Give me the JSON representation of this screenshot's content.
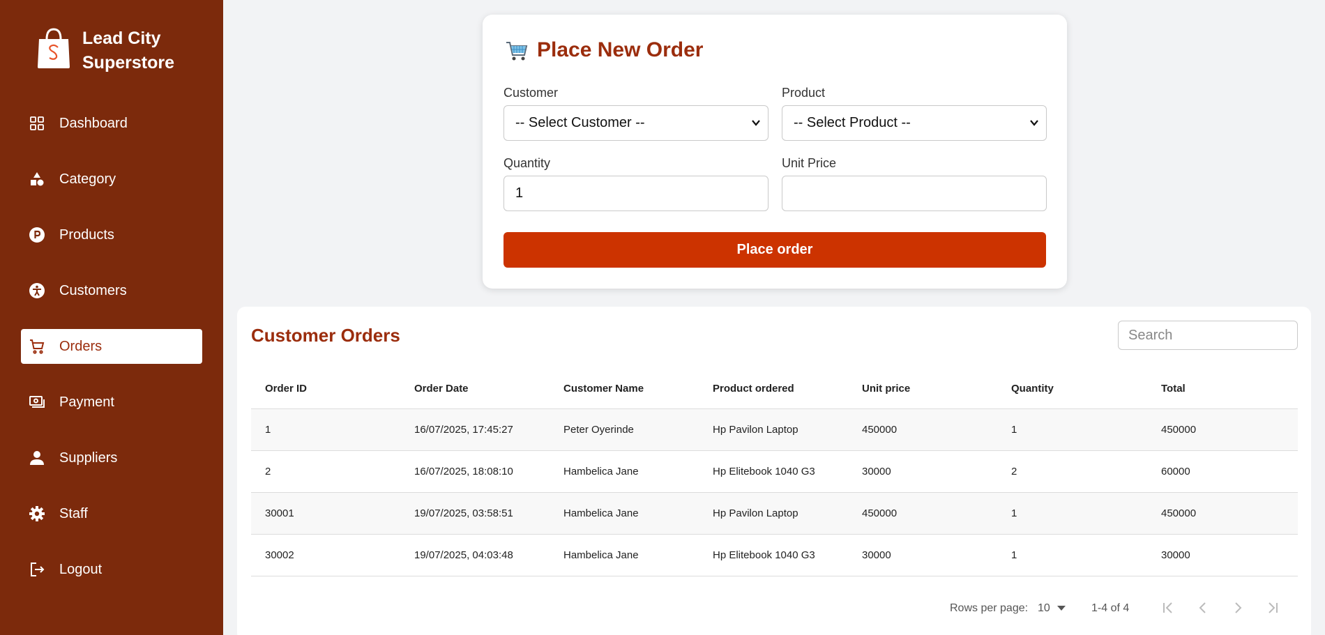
{
  "brand": {
    "line1": "Lead City",
    "line2": "Superstore"
  },
  "nav": [
    {
      "label": "Dashboard",
      "icon": "dashboard-icon"
    },
    {
      "label": "Category",
      "icon": "category-icon"
    },
    {
      "label": "Products",
      "icon": "products-icon"
    },
    {
      "label": "Customers",
      "icon": "customers-icon"
    },
    {
      "label": "Orders",
      "icon": "cart-icon"
    },
    {
      "label": "Payment",
      "icon": "payment-icon"
    },
    {
      "label": "Suppliers",
      "icon": "person-icon"
    },
    {
      "label": "Staff",
      "icon": "gear-icon"
    },
    {
      "label": "Logout",
      "icon": "logout-icon"
    }
  ],
  "form": {
    "title": "Place New Order",
    "customer_label": "Customer",
    "customer_value": "-- Select Customer --",
    "product_label": "Product",
    "product_value": "-- Select Product --",
    "quantity_label": "Quantity",
    "quantity_value": "1",
    "unit_price_label": "Unit Price",
    "unit_price_value": "",
    "submit_label": "Place order"
  },
  "orders": {
    "title": "Customer Orders",
    "search_placeholder": "Search",
    "columns": [
      "Order ID",
      "Order Date",
      "Customer Name",
      "Product ordered",
      "Unit price",
      "Quantity",
      "Total"
    ],
    "rows": [
      [
        "1",
        "16/07/2025, 17:45:27",
        "Peter Oyerinde",
        "Hp Pavilon Laptop",
        "450000",
        "1",
        "450000"
      ],
      [
        "2",
        "16/07/2025, 18:08:10",
        "Hambelica Jane",
        "Hp Elitebook 1040 G3",
        "30000",
        "2",
        "60000"
      ],
      [
        "30001",
        "19/07/2025, 03:58:51",
        "Hambelica Jane",
        "Hp Pavilon Laptop",
        "450000",
        "1",
        "450000"
      ],
      [
        "30002",
        "19/07/2025, 04:03:48",
        "Hambelica Jane",
        "Hp Elitebook 1040 G3",
        "30000",
        "1",
        "30000"
      ]
    ],
    "pager": {
      "rows_label": "Rows per page:",
      "rows_value": "10",
      "range": "1-4 of 4"
    }
  },
  "colors": {
    "sidebar": "#7c2a0c",
    "accent": "#9b2d0d",
    "button": "#cc3300"
  }
}
